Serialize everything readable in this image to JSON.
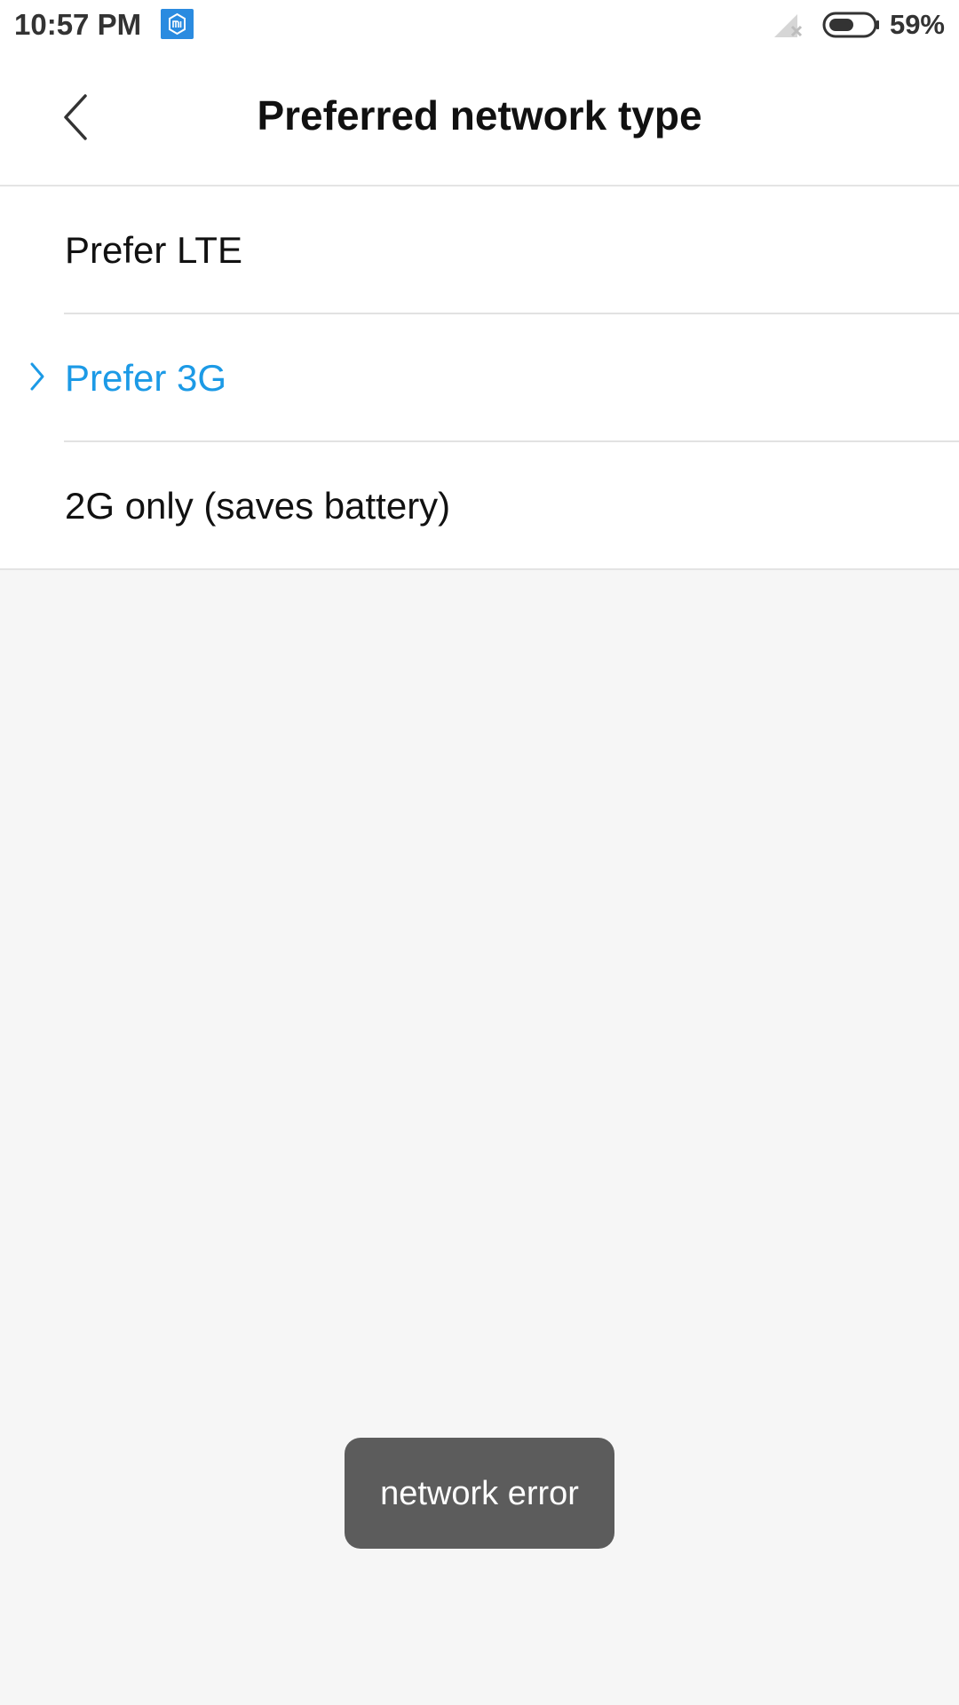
{
  "status_bar": {
    "time": "10:57 PM",
    "battery_percent": "59%",
    "battery_level": 0.59,
    "icons": [
      "mi-notification-icon",
      "signal-no-service-icon",
      "battery-icon"
    ]
  },
  "app_bar": {
    "title": "Preferred network type",
    "back_icon": "chevron-left-icon"
  },
  "options": [
    {
      "label": "Prefer LTE",
      "selected": false
    },
    {
      "label": "Prefer 3G",
      "selected": true
    },
    {
      "label": "2G only (saves battery)",
      "selected": false
    }
  ],
  "toast": {
    "message": "network error"
  },
  "colors": {
    "accent": "#1c9ae6",
    "background": "#f6f6f6",
    "toast_bg": "#5c5c5c"
  }
}
